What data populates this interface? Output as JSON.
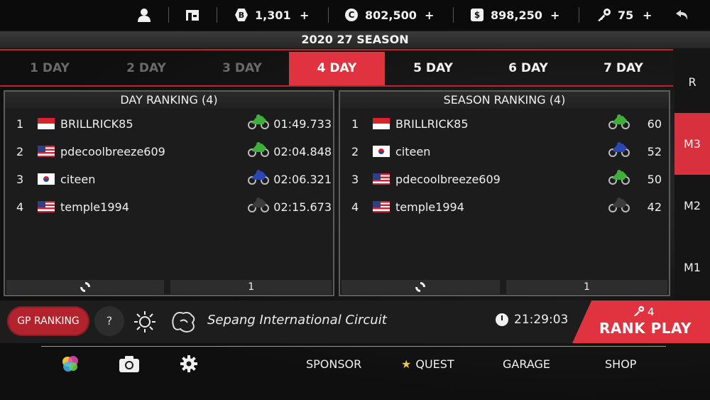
{
  "topbar": {
    "user_icon": "person-icon",
    "garage_icon": "building-icon",
    "currency_b": {
      "icon": "b-coin-icon",
      "glyph": "B",
      "value": "1,301"
    },
    "currency_c": {
      "icon": "c-coin-icon",
      "glyph": "C",
      "value": "802,500"
    },
    "currency_s": {
      "icon": "dollar-icon",
      "glyph": "$",
      "value": "898,250"
    },
    "keys": {
      "icon": "key-icon",
      "value": "75"
    },
    "plus": "+",
    "back_icon": "back-arrow-icon"
  },
  "season": {
    "title": "2020 27 SEASON"
  },
  "days": [
    "1 DAY",
    "2 DAY",
    "3 DAY",
    "4 DAY",
    "5 DAY",
    "6 DAY",
    "7 DAY"
  ],
  "active_day_index": 3,
  "side_tabs": [
    "R",
    "M3",
    "M2",
    "M1"
  ],
  "active_side_tab": "M3",
  "day_ranking": {
    "title": "DAY RANKING (4)",
    "rows": [
      {
        "rank": "1",
        "flag": "indonesia",
        "name": "BRILLRICK85",
        "bike": "green",
        "value": "01:49.733"
      },
      {
        "rank": "2",
        "flag": "usa",
        "name": "pdecoolbreeze609",
        "bike": "green",
        "value": "02:04.848"
      },
      {
        "rank": "3",
        "flag": "korea",
        "name": "citeen",
        "bike": "blue",
        "value": "02:06.321"
      },
      {
        "rank": "4",
        "flag": "usa",
        "name": "temple1994",
        "bike": "black",
        "value": "02:15.673"
      }
    ],
    "page": "1"
  },
  "season_ranking": {
    "title": "SEASON RANKING (4)",
    "rows": [
      {
        "rank": "1",
        "flag": "indonesia",
        "name": "BRILLRICK85",
        "bike": "green",
        "value": "60"
      },
      {
        "rank": "2",
        "flag": "korea",
        "name": "citeen",
        "bike": "blue",
        "value": "52"
      },
      {
        "rank": "3",
        "flag": "usa",
        "name": "pdecoolbreeze609",
        "bike": "green",
        "value": "50"
      },
      {
        "rank": "4",
        "flag": "usa",
        "name": "temple1994",
        "bike": "black",
        "value": "42"
      }
    ],
    "page": "1"
  },
  "infobar": {
    "gp_ranking": "GP RANKING",
    "help": "?",
    "circuit": "Sepang International Circuit",
    "time": "21:29:03"
  },
  "rank_play": {
    "keys": "4",
    "label": "RANK PLAY"
  },
  "nav": {
    "sponsor": "SPONSOR",
    "quest": "QUEST",
    "garage": "GARAGE",
    "shop": "SHOP"
  },
  "colors": {
    "accent_red": "#e0323f",
    "bike_green": "#3fae3a",
    "bike_blue": "#2c46b4",
    "bike_black": "#3c3c3c"
  }
}
